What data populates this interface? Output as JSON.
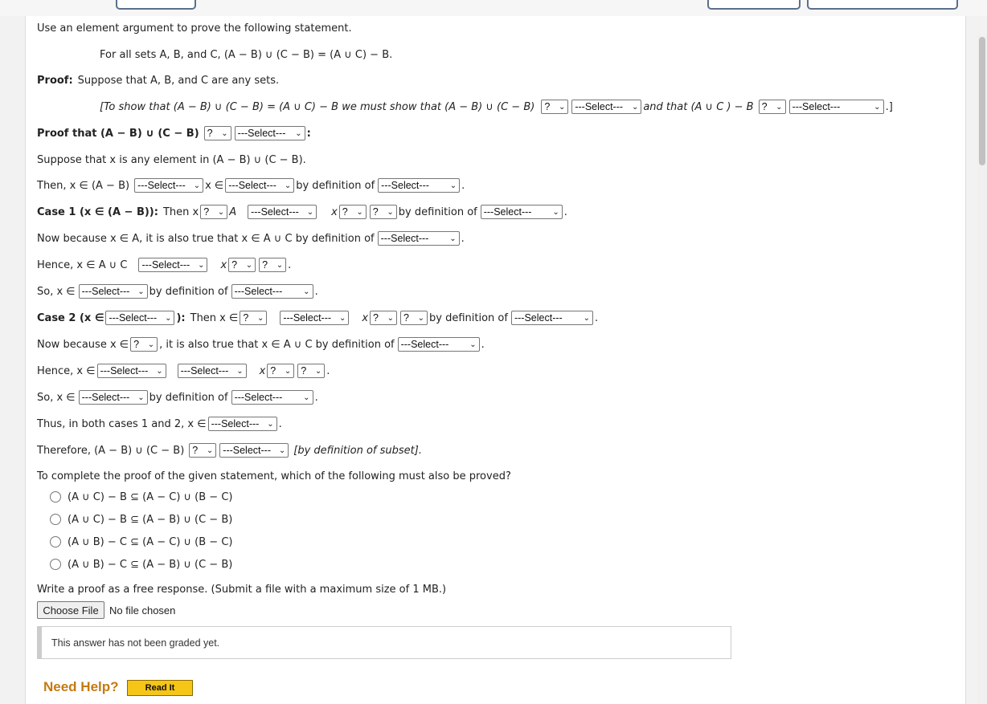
{
  "sel": "---Select---",
  "q": "?",
  "chev": "⌄",
  "intro": "Use an element argument to prove the following statement.",
  "statement": "For all sets A, B, and C, (A − B) ∪ (C − B) = (A ∪ C) − B.",
  "proof_label": "Proof:",
  "proof_text": "Suppose that A, B, and C are any sets.",
  "to_show_a": "[To show that (A − B) ∪ (C − B) = (A ∪ C) − B we must show that (A − B) ∪ (C − B)",
  "to_show_b": "and that (A ∪ C ) − B",
  "to_show_c": ".]",
  "proof_that": "Proof that (A − B) ∪ (C − B)",
  "colon": ":",
  "suppose_x": "Suppose that x is any element in (A − B) ∪ (C − B).",
  "then_x": "Then, x ∈ (A − B)",
  "x_in": "x ∈",
  "by_def_of": "by definition of",
  "period": ".",
  "case1_label": "Case 1 (x ∈ (A − B)):",
  "then_x_short": "Then x",
  "A": "A",
  "x": "x",
  "now_because_1": "Now because x ∈ A, it is also true that x ∈ A ∪ C by definition of",
  "hence_1": "Hence, x ∈ A ∪ C",
  "so_x": "So, x ∈",
  "case2_label_a": "Case 2 (x ∈",
  "case2_label_b": "):",
  "then_x_in": "Then x ∈",
  "now_because_2a": "Now because x ∈",
  "now_because_2b": ", it is also true that x ∈ A ∪ C by definition of",
  "hence_2": "Hence, x ∈",
  "thus": "Thus, in both cases 1 and 2, x ∈",
  "therefore": "Therefore, (A − B) ∪ (C − B)",
  "by_def_subset": "[by definition of subset].",
  "question": "To complete the proof of the given statement, which of the following must also be proved?",
  "options": [
    "(A ∪ C) − B ⊆ (A − C) ∪ (B − C)",
    "(A ∪ C) − B ⊆ (A − B) ∪ (C − B)",
    "(A ∪ B) − C ⊆ (A − C) ∪ (B − C)",
    "(A ∪ B) − C ⊆ (A − B) ∪ (C − B)"
  ],
  "write_proof": "Write a proof as a free response. (Submit a file with a maximum size of 1 MB.)",
  "choose_file": "Choose File",
  "no_file": "No file chosen",
  "not_graded": "This answer has not been graded yet.",
  "need_help": "Need Help?",
  "read_it": "Read It"
}
